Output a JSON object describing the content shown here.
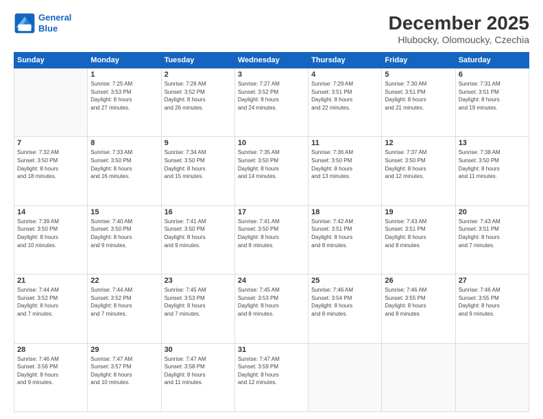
{
  "logo": {
    "line1": "General",
    "line2": "Blue"
  },
  "title": "December 2025",
  "subtitle": "Hlubocky, Olomoucky, Czechia",
  "days_header": [
    "Sunday",
    "Monday",
    "Tuesday",
    "Wednesday",
    "Thursday",
    "Friday",
    "Saturday"
  ],
  "weeks": [
    [
      {
        "day": "",
        "info": ""
      },
      {
        "day": "1",
        "info": "Sunrise: 7:25 AM\nSunset: 3:53 PM\nDaylight: 8 hours\nand 27 minutes."
      },
      {
        "day": "2",
        "info": "Sunrise: 7:26 AM\nSunset: 3:52 PM\nDaylight: 8 hours\nand 26 minutes."
      },
      {
        "day": "3",
        "info": "Sunrise: 7:27 AM\nSunset: 3:52 PM\nDaylight: 8 hours\nand 24 minutes."
      },
      {
        "day": "4",
        "info": "Sunrise: 7:29 AM\nSunset: 3:51 PM\nDaylight: 8 hours\nand 22 minutes."
      },
      {
        "day": "5",
        "info": "Sunrise: 7:30 AM\nSunset: 3:51 PM\nDaylight: 8 hours\nand 21 minutes."
      },
      {
        "day": "6",
        "info": "Sunrise: 7:31 AM\nSunset: 3:51 PM\nDaylight: 8 hours\nand 19 minutes."
      }
    ],
    [
      {
        "day": "7",
        "info": "Sunrise: 7:32 AM\nSunset: 3:50 PM\nDaylight: 8 hours\nand 18 minutes."
      },
      {
        "day": "8",
        "info": "Sunrise: 7:33 AM\nSunset: 3:50 PM\nDaylight: 8 hours\nand 16 minutes."
      },
      {
        "day": "9",
        "info": "Sunrise: 7:34 AM\nSunset: 3:50 PM\nDaylight: 8 hours\nand 15 minutes."
      },
      {
        "day": "10",
        "info": "Sunrise: 7:35 AM\nSunset: 3:50 PM\nDaylight: 8 hours\nand 14 minutes."
      },
      {
        "day": "11",
        "info": "Sunrise: 7:36 AM\nSunset: 3:50 PM\nDaylight: 8 hours\nand 13 minutes."
      },
      {
        "day": "12",
        "info": "Sunrise: 7:37 AM\nSunset: 3:50 PM\nDaylight: 8 hours\nand 12 minutes."
      },
      {
        "day": "13",
        "info": "Sunrise: 7:38 AM\nSunset: 3:50 PM\nDaylight: 8 hours\nand 11 minutes."
      }
    ],
    [
      {
        "day": "14",
        "info": "Sunrise: 7:39 AM\nSunset: 3:50 PM\nDaylight: 8 hours\nand 10 minutes."
      },
      {
        "day": "15",
        "info": "Sunrise: 7:40 AM\nSunset: 3:50 PM\nDaylight: 8 hours\nand 9 minutes."
      },
      {
        "day": "16",
        "info": "Sunrise: 7:41 AM\nSunset: 3:50 PM\nDaylight: 8 hours\nand 9 minutes."
      },
      {
        "day": "17",
        "info": "Sunrise: 7:41 AM\nSunset: 3:50 PM\nDaylight: 8 hours\nand 8 minutes."
      },
      {
        "day": "18",
        "info": "Sunrise: 7:42 AM\nSunset: 3:51 PM\nDaylight: 8 hours\nand 8 minutes."
      },
      {
        "day": "19",
        "info": "Sunrise: 7:43 AM\nSunset: 3:51 PM\nDaylight: 8 hours\nand 8 minutes."
      },
      {
        "day": "20",
        "info": "Sunrise: 7:43 AM\nSunset: 3:51 PM\nDaylight: 8 hours\nand 7 minutes."
      }
    ],
    [
      {
        "day": "21",
        "info": "Sunrise: 7:44 AM\nSunset: 3:52 PM\nDaylight: 8 hours\nand 7 minutes."
      },
      {
        "day": "22",
        "info": "Sunrise: 7:44 AM\nSunset: 3:52 PM\nDaylight: 8 hours\nand 7 minutes."
      },
      {
        "day": "23",
        "info": "Sunrise: 7:45 AM\nSunset: 3:53 PM\nDaylight: 8 hours\nand 7 minutes."
      },
      {
        "day": "24",
        "info": "Sunrise: 7:45 AM\nSunset: 3:53 PM\nDaylight: 8 hours\nand 8 minutes."
      },
      {
        "day": "25",
        "info": "Sunrise: 7:46 AM\nSunset: 3:54 PM\nDaylight: 8 hours\nand 8 minutes."
      },
      {
        "day": "26",
        "info": "Sunrise: 7:46 AM\nSunset: 3:55 PM\nDaylight: 8 hours\nand 8 minutes."
      },
      {
        "day": "27",
        "info": "Sunrise: 7:46 AM\nSunset: 3:55 PM\nDaylight: 8 hours\nand 9 minutes."
      }
    ],
    [
      {
        "day": "28",
        "info": "Sunrise: 7:46 AM\nSunset: 3:56 PM\nDaylight: 8 hours\nand 9 minutes."
      },
      {
        "day": "29",
        "info": "Sunrise: 7:47 AM\nSunset: 3:57 PM\nDaylight: 8 hours\nand 10 minutes."
      },
      {
        "day": "30",
        "info": "Sunrise: 7:47 AM\nSunset: 3:58 PM\nDaylight: 8 hours\nand 11 minutes."
      },
      {
        "day": "31",
        "info": "Sunrise: 7:47 AM\nSunset: 3:59 PM\nDaylight: 8 hours\nand 12 minutes."
      },
      {
        "day": "",
        "info": ""
      },
      {
        "day": "",
        "info": ""
      },
      {
        "day": "",
        "info": ""
      }
    ]
  ]
}
